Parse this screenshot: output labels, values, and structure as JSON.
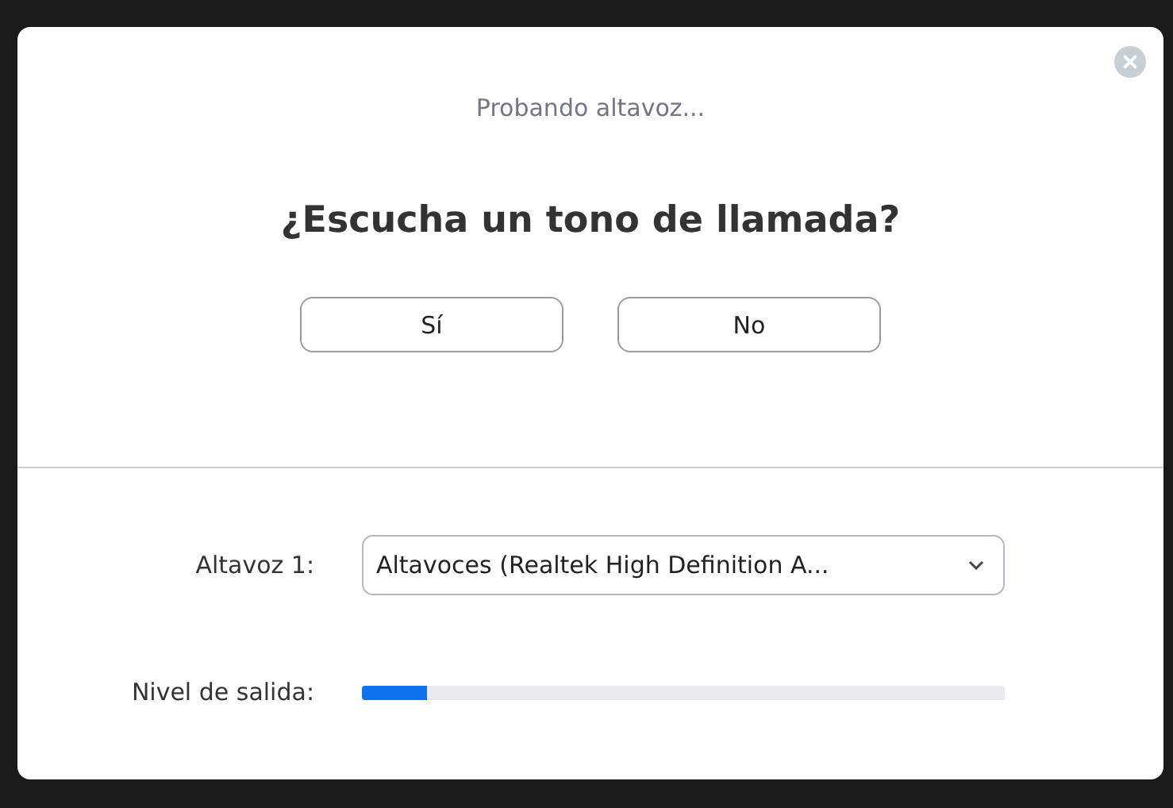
{
  "dialog": {
    "status": "Probando altavoz...",
    "question": "¿Escucha un tono de llamada?",
    "buttons": [
      "Sí",
      "No"
    ]
  },
  "speaker": {
    "label": "Altavoz 1:",
    "value": "Altavoces (Realtek High Definition A..."
  },
  "output_level": {
    "label": "Nivel de salida:",
    "level": 0.1
  }
}
